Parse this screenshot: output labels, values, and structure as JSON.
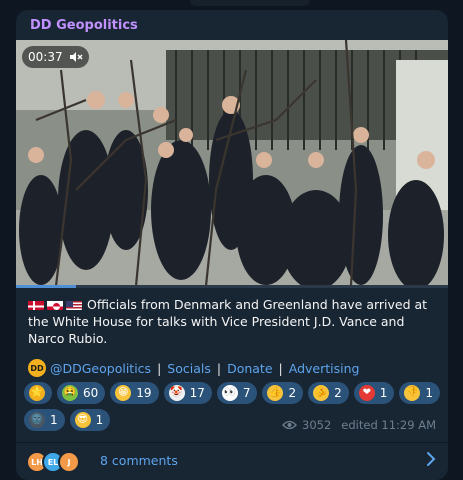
{
  "post": {
    "channel_name": "DD Geopolitics",
    "video": {
      "time": "00:37",
      "muted": true,
      "progress": 0.14
    },
    "text": "Officials from Denmark and Greenland have arrived at the White House for talks with Vice President J.D. Vance and Narco Rubio.",
    "flags": [
      "Denmark",
      "Greenland",
      "USA"
    ],
    "links": {
      "handle": "@DDGeopolitics",
      "items": [
        "Socials",
        "Donate",
        "Advertising"
      ],
      "separator": "|",
      "logo_text": "DD"
    },
    "reactions": [
      {
        "icon": "star-icon",
        "emoji": "⭐",
        "count": "",
        "color": "#f2b01e"
      },
      {
        "icon": "nauseated-face-icon",
        "emoji": "🤮",
        "count": "60",
        "color": "#7cc242"
      },
      {
        "icon": "grinning-face-icon",
        "emoji": "😁",
        "count": "19",
        "color": "#f6c33b"
      },
      {
        "icon": "clown-face-icon",
        "emoji": "🤡",
        "count": "17",
        "color": "#f1f1f1"
      },
      {
        "icon": "eyes-icon",
        "emoji": "👀",
        "count": "7",
        "color": "#ffffff"
      },
      {
        "icon": "thumbs-up-icon",
        "emoji": "👍",
        "count": "2",
        "color": "#f6c33b"
      },
      {
        "icon": "pointing-hand-icon",
        "emoji": "🫵",
        "count": "2",
        "color": "#f6c33b"
      },
      {
        "icon": "red-heart-icon",
        "emoji": "❤",
        "count": "1",
        "color": "#e53935"
      },
      {
        "icon": "thumbs-down-icon",
        "emoji": "👎",
        "count": "1",
        "color": "#f6c33b"
      },
      {
        "icon": "new-moon-face-icon",
        "emoji": "🌚",
        "count": "1",
        "color": "#4a5563"
      },
      {
        "icon": "sunglasses-face-icon",
        "emoji": "😎",
        "count": "1",
        "color": "#f6c33b"
      }
    ],
    "views": "3052",
    "edited": "edited 11:29 AM",
    "comments": {
      "label": "8 comments",
      "avatars": [
        {
          "initials": "LH",
          "color": "#f39a48"
        },
        {
          "initials": "EL",
          "color": "#3fa8e8"
        },
        {
          "initials": "J",
          "color": "#f39a48"
        }
      ]
    }
  }
}
